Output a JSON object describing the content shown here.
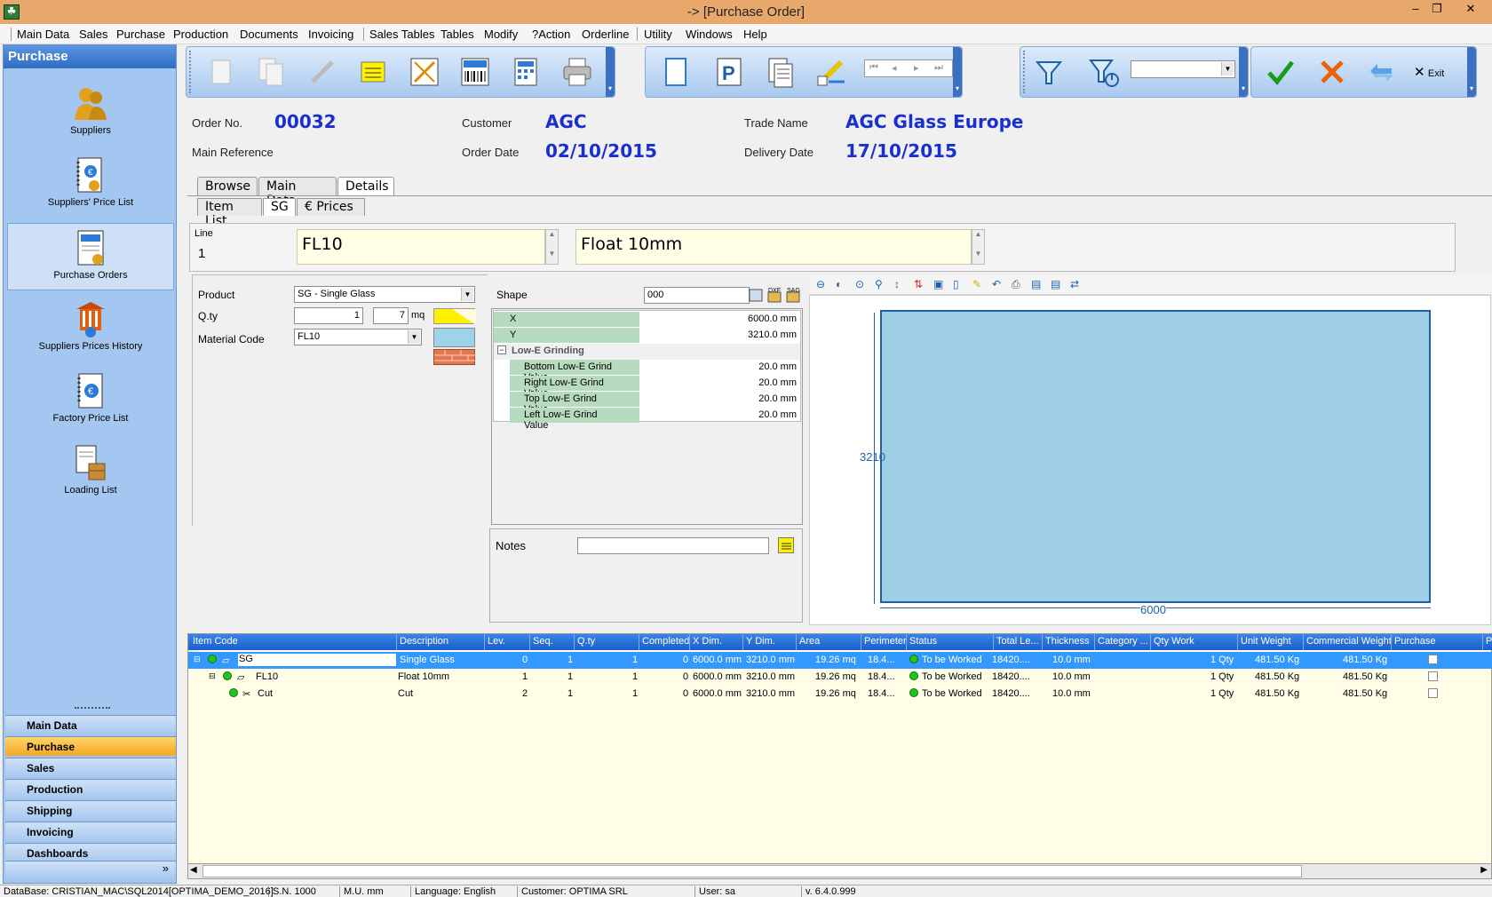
{
  "window": {
    "title": "-> [Purchase Order]",
    "min": "‒",
    "max": "❐",
    "close": "✕"
  },
  "menu": {
    "items": [
      "Main Data",
      "Sales",
      "Purchase",
      "Production",
      "Documents",
      "Invoicing",
      "Sales Tables",
      "Tables",
      "Modify",
      "?Action",
      "Orderline",
      "Utility",
      "Windows",
      "Help"
    ]
  },
  "sidebar": {
    "header": "Purchase",
    "items": [
      {
        "label": "Suppliers",
        "icon": "suppliers-icon"
      },
      {
        "label": "Suppliers' Price List",
        "icon": "price-list-icon"
      },
      {
        "label": "Purchase Orders",
        "icon": "purchase-orders-icon"
      },
      {
        "label": "Suppliers Prices History",
        "icon": "prices-history-icon"
      },
      {
        "label": "Factory Price List",
        "icon": "factory-price-list-icon"
      },
      {
        "label": "Loading List",
        "icon": "loading-list-icon"
      }
    ],
    "sections": [
      "Main Data",
      "Purchase",
      "Sales",
      "Production",
      "Shipping",
      "Invoicing",
      "Dashboards"
    ],
    "expand": "»"
  },
  "toolbar": {
    "exit_label": "Exit",
    "combo_value": ""
  },
  "order": {
    "order_no_label": "Order No.",
    "order_no": "00032",
    "customer_label": "Customer",
    "customer": "AGC",
    "trade_name_label": "Trade Name",
    "trade_name": "AGC Glass Europe",
    "main_ref_label": "Main Reference",
    "order_date_label": "Order Date",
    "order_date": "02/10/2015",
    "delivery_date_label": "Delivery Date",
    "delivery_date": "17/10/2015"
  },
  "tabs": {
    "browse": "Browse",
    "main_data": "Main Data",
    "details": "Details"
  },
  "subtabs": {
    "item_list": "Item List",
    "sg": "SG",
    "prices": "€ Prices"
  },
  "line": {
    "label": "Line",
    "value": "1",
    "code": "FL10",
    "description": "Float 10mm"
  },
  "form": {
    "product_label": "Product",
    "product_value": "SG - Single Glass",
    "qty_label": "Q.ty",
    "qty_value": "1",
    "qty_area": "7",
    "qty_unit": "mq",
    "material_label": "Material Code",
    "material_value": "FL10",
    "shape_label": "Shape",
    "shape_value": "000",
    "notes_label": "Notes",
    "notes_value": ""
  },
  "properties": {
    "x_label": "X",
    "x_value": "6000.0 mm",
    "y_label": "Y",
    "y_value": "3210.0 mm",
    "group_label": "Low-E Grinding",
    "rows": [
      {
        "label": "Bottom Low-E Grind Value",
        "value": "20.0 mm"
      },
      {
        "label": "Right Low-E Grind Value",
        "value": "20.0 mm"
      },
      {
        "label": "Top Low-E Grind Value",
        "value": "20.0 mm"
      },
      {
        "label": "Left Low-E Grind Value",
        "value": "20.0 mm"
      }
    ]
  },
  "drawing": {
    "width_label": "6000",
    "height_label": "3210"
  },
  "grid": {
    "columns": [
      "Item Code",
      "Description",
      "Lev.",
      "Seq.",
      "Q.ty",
      "Completed",
      "X Dim.",
      "Y Dim.",
      "Area",
      "Perimeter",
      "Status",
      "Total Le...",
      "Thickness",
      "Category ...",
      "Qty Work",
      "Unit Weight",
      "Commercial Weight",
      "Purchase",
      "Pu"
    ],
    "rows": [
      {
        "code": "SG",
        "desc": "Single Glass",
        "lev": "0",
        "seq": "1",
        "qty": "1",
        "completed": "0",
        "xdim": "6000.0 mm",
        "ydim": "3210.0 mm",
        "area": "19.26 mq",
        "perimeter": "18.4...",
        "status": "To be Worked",
        "total": "18420....",
        "thickness": "10.0 mm",
        "category": "",
        "qtywork": "1 Qty",
        "unitweight": "481.50 Kg",
        "commweight": "481.50 Kg"
      },
      {
        "code": "FL10",
        "desc": "Float 10mm",
        "lev": "1",
        "seq": "1",
        "qty": "1",
        "completed": "0",
        "xdim": "6000.0 mm",
        "ydim": "3210.0 mm",
        "area": "19.26 mq",
        "perimeter": "18.4...",
        "status": "To be Worked",
        "total": "18420....",
        "thickness": "10.0 mm",
        "category": "",
        "qtywork": "1 Qty",
        "unitweight": "481.50 Kg",
        "commweight": "481.50 Kg"
      },
      {
        "code": "Cut",
        "desc": "Cut",
        "lev": "2",
        "seq": "1",
        "qty": "1",
        "completed": "0",
        "xdim": "6000.0 mm",
        "ydim": "3210.0 mm",
        "area": "19.26 mq",
        "perimeter": "18.4...",
        "status": "To be Worked",
        "total": "18420....",
        "thickness": "10.0 mm",
        "category": "",
        "qtywork": "1 Qty",
        "unitweight": "481.50 Kg",
        "commweight": "481.50 Kg"
      }
    ]
  },
  "status": {
    "database": "DataBase: CRISTIAN_MAC\\SQL2014[OPTIMA_DEMO_2016]",
    "sn": "S.N. 1000",
    "mu": "M.U. mm",
    "language": "Language: English",
    "customer": "Customer: OPTIMA SRL",
    "user": "User: sa",
    "version": "v. 6.4.0.999"
  },
  "colors": {
    "accent": "#1a2fd0",
    "title_bar": "#e9a86b",
    "selected_row": "#3399ff",
    "glass": "#9fcfe4"
  }
}
